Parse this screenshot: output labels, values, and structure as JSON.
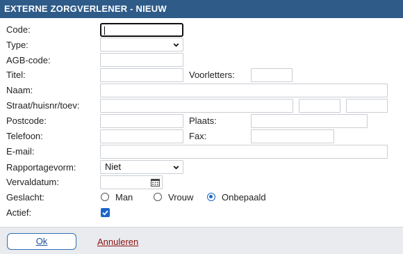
{
  "dialog": {
    "title": "EXTERNE ZORGVERLENER - NIEUW"
  },
  "form": {
    "code_label": "Code:",
    "type_label": "Type:",
    "type_value": "",
    "agb_label": "AGB-code:",
    "titel_label": "Titel:",
    "voorletters_label": "Voorletters:",
    "naam_label": "Naam:",
    "straat_label": "Straat/huisnr/toev:",
    "postcode_label": "Postcode:",
    "plaats_label": "Plaats:",
    "telefoon_label": "Telefoon:",
    "fax_label": "Fax:",
    "email_label": "E-mail:",
    "rapportage_label": "Rapportagevorm:",
    "rapportage_value": "Niet",
    "vervaldatum_label": "Vervaldatum:",
    "geslacht_label": "Geslacht:",
    "geslacht_options": [
      "Man",
      "Vrouw",
      "Onbepaald"
    ],
    "geslacht_selected": "Onbepaald",
    "actief_label": "Actief:",
    "actief_checked": true
  },
  "footer": {
    "ok_label": "Ok",
    "cancel_label": "Annuleren"
  },
  "colors": {
    "titlebar": "#2f5b89",
    "accent": "#1a66c9",
    "cancel": "#8a1010"
  }
}
